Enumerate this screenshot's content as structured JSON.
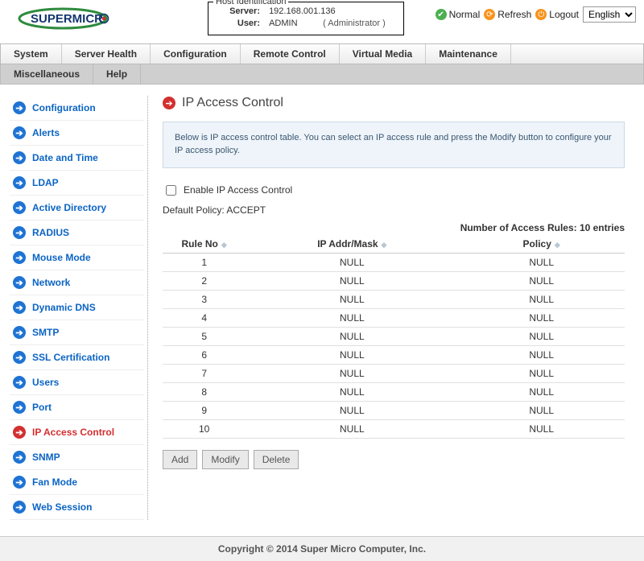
{
  "host_id": {
    "legend": "Host Identification",
    "server_lbl": "Server:",
    "server_val": "192.168.001.136",
    "user_lbl": "User:",
    "user_val": "ADMIN",
    "user_role": "( Administrator )"
  },
  "top": {
    "status": "Normal",
    "refresh": "Refresh",
    "logout": "Logout",
    "lang": "English"
  },
  "menu": {
    "items": [
      "System",
      "Server Health",
      "Configuration",
      "Remote Control",
      "Virtual Media",
      "Maintenance"
    ],
    "sub": [
      "Miscellaneous",
      "Help"
    ]
  },
  "sidebar": {
    "items": [
      {
        "label": "Configuration",
        "active": false
      },
      {
        "label": "Alerts",
        "active": false
      },
      {
        "label": "Date and Time",
        "active": false
      },
      {
        "label": "LDAP",
        "active": false
      },
      {
        "label": "Active Directory",
        "active": false
      },
      {
        "label": "RADIUS",
        "active": false
      },
      {
        "label": "Mouse Mode",
        "active": false
      },
      {
        "label": "Network",
        "active": false
      },
      {
        "label": "Dynamic DNS",
        "active": false
      },
      {
        "label": "SMTP",
        "active": false
      },
      {
        "label": "SSL Certification",
        "active": false
      },
      {
        "label": "Users",
        "active": false
      },
      {
        "label": "Port",
        "active": false
      },
      {
        "label": "IP Access Control",
        "active": true
      },
      {
        "label": "SNMP",
        "active": false
      },
      {
        "label": "Fan Mode",
        "active": false
      },
      {
        "label": "Web Session",
        "active": false
      }
    ]
  },
  "page": {
    "title": "IP Access Control",
    "description": "Below is IP access control table. You can select an IP access rule and press the Modify button to configure your IP access policy.",
    "enable_label": "Enable IP Access Control",
    "default_policy_label": "Default Policy: ACCEPT",
    "counter_label": "Number of Access Rules: 10 entries",
    "columns": {
      "rule": "Rule No",
      "ip": "IP Addr/Mask",
      "policy": "Policy"
    },
    "rows": [
      {
        "no": "1",
        "ip": "NULL",
        "policy": "NULL"
      },
      {
        "no": "2",
        "ip": "NULL",
        "policy": "NULL"
      },
      {
        "no": "3",
        "ip": "NULL",
        "policy": "NULL"
      },
      {
        "no": "4",
        "ip": "NULL",
        "policy": "NULL"
      },
      {
        "no": "5",
        "ip": "NULL",
        "policy": "NULL"
      },
      {
        "no": "6",
        "ip": "NULL",
        "policy": "NULL"
      },
      {
        "no": "7",
        "ip": "NULL",
        "policy": "NULL"
      },
      {
        "no": "8",
        "ip": "NULL",
        "policy": "NULL"
      },
      {
        "no": "9",
        "ip": "NULL",
        "policy": "NULL"
      },
      {
        "no": "10",
        "ip": "NULL",
        "policy": "NULL"
      }
    ],
    "buttons": {
      "add": "Add",
      "modify": "Modify",
      "delete": "Delete"
    }
  },
  "footer": "Copyright © 2014 Super Micro Computer, Inc."
}
